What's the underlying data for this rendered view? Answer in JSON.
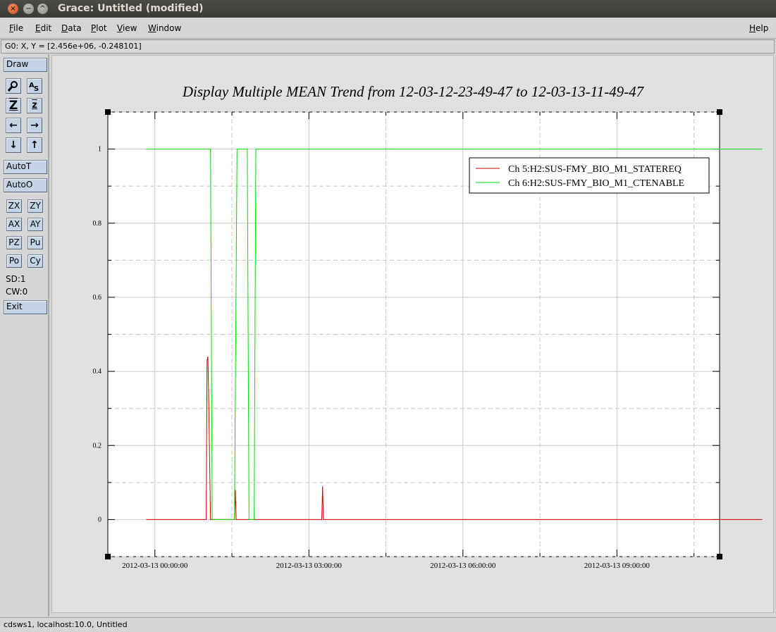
{
  "window": {
    "title": "Grace: Untitled (modified)",
    "close_glyph": "×",
    "min_glyph": "−",
    "max_glyph": "^"
  },
  "menu": {
    "items": [
      "File",
      "Edit",
      "Data",
      "Plot",
      "View",
      "Window"
    ],
    "help": "Help"
  },
  "coord_readout": "G0: X, Y = [2.456e+06, -0.248101]",
  "toolbar": {
    "draw": "Draw",
    "autot": "AutoT",
    "autoo": "AutoO",
    "zx": "ZX",
    "zy": "ZY",
    "ax": "AX",
    "ay": "AY",
    "pz": "PZ",
    "pu": "Pu",
    "po": "Po",
    "cy": "Cy",
    "sd": "SD:1",
    "cw": "CW:0",
    "exit": "Exit",
    "icons": {
      "zoom": "magnifier-icon",
      "text": "text-autoscale-icon",
      "zoom_area": "Z",
      "zoom_small": "z",
      "left": "←",
      "right": "→",
      "down": "↓",
      "up": "↑"
    }
  },
  "status": "cdsws1, localhost:10.0, Untitled",
  "colors": {
    "series1": "#cc0000",
    "series2": "#00dd00",
    "grid": "#c8c8c8"
  },
  "chart_data": {
    "type": "line",
    "title": "Display Multiple MEAN Trend from 12-03-12-23-49-47 to 12-03-13-11-49-47",
    "xlabel": "",
    "ylabel": "",
    "xlim": [
      "2012-03-12 23:05:00",
      "2012-03-13 11:00:00"
    ],
    "ylim": [
      -0.1,
      1.1
    ],
    "xticks": [
      "2012-03-13 00:00:00",
      "2012-03-13 03:00:00",
      "2012-03-13 06:00:00",
      "2012-03-13 09:00:00"
    ],
    "yticks": [
      "0",
      "0.2",
      "0.4",
      "0.6",
      "0.8",
      "1"
    ],
    "grid": true,
    "legend_position": "top-right",
    "series": [
      {
        "name": "Ch 5:H2:SUS-FMY_BIO_M1_STATEREQ",
        "color": "#cc0000",
        "points": [
          [
            "2012-03-12 23:49:47",
            0
          ],
          [
            "2012-03-13 01:00:00",
            0
          ],
          [
            "2012-03-13 01:01:00",
            0.43
          ],
          [
            "2012-03-13 01:02:00",
            0.44
          ],
          [
            "2012-03-13 01:03:00",
            0.3
          ],
          [
            "2012-03-13 01:05:00",
            0
          ],
          [
            "2012-03-13 01:33:00",
            0
          ],
          [
            "2012-03-13 01:34:00",
            0.08
          ],
          [
            "2012-03-13 01:35:00",
            0
          ],
          [
            "2012-03-13 03:15:00",
            0
          ],
          [
            "2012-03-13 03:16:00",
            0.09
          ],
          [
            "2012-03-13 03:17:00",
            0
          ],
          [
            "2012-03-13 11:49:47",
            0
          ]
        ]
      },
      {
        "name": "Ch 6:H2:SUS-FMY_BIO_M1_CTENABLE",
        "color": "#00dd00",
        "points": [
          [
            "2012-03-12 23:49:47",
            1
          ],
          [
            "2012-03-13 01:05:00",
            1
          ],
          [
            "2012-03-13 01:07:00",
            0
          ],
          [
            "2012-03-13 01:33:00",
            0
          ],
          [
            "2012-03-13 01:36:00",
            1
          ],
          [
            "2012-03-13 01:48:00",
            1
          ],
          [
            "2012-03-13 01:50:00",
            0
          ],
          [
            "2012-03-13 01:56:00",
            0
          ],
          [
            "2012-03-13 01:58:00",
            1
          ],
          [
            "2012-03-13 11:49:47",
            1
          ]
        ]
      }
    ]
  }
}
